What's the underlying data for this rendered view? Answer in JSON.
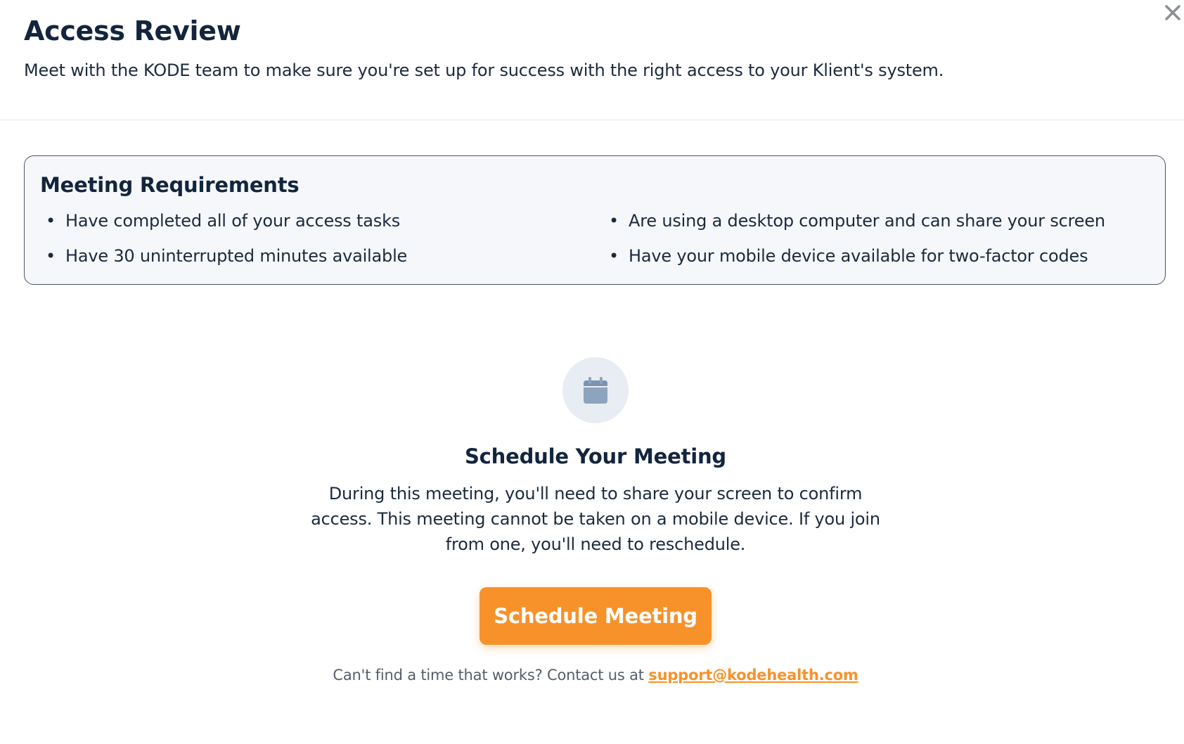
{
  "header": {
    "title": "Access Review",
    "subtitle": "Meet with the KODE team to make sure you're set up for success with the right access to your Klient's system."
  },
  "close": {
    "icon": "close-icon",
    "glyph": "✕"
  },
  "requirements": {
    "title": "Meeting Requirements",
    "bullet": "•",
    "left_items": [
      "Have completed all of your access tasks",
      "Have 30 uninterrupted minutes available"
    ],
    "right_items": [
      "Are using a desktop computer and can share your screen",
      "Have your mobile device available for two-factor codes"
    ]
  },
  "schedule": {
    "icon": "calendar-icon",
    "title": "Schedule Your Meeting",
    "description": "During this meeting, you'll need to share your screen to confirm access. This meeting cannot be taken on a mobile device. If you join from one, you'll need to reschedule.",
    "button_label": "Schedule Meeting",
    "footer_prefix": "Can't find a time that works? Contact us at ",
    "support_email": "support@kodehealth.com"
  },
  "colors": {
    "accent": "#f7922a",
    "heading": "#13253d",
    "box_bg": "#f5f7fa",
    "icon": "#8da4bf"
  }
}
